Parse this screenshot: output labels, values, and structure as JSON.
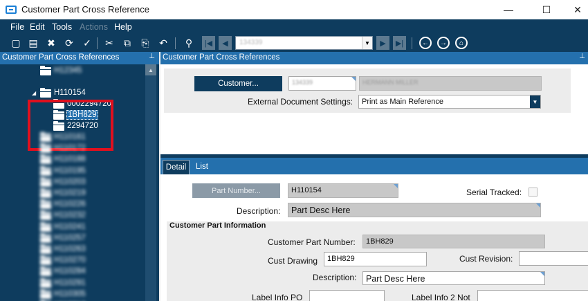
{
  "window": {
    "title": "Customer Part Cross Reference",
    "minimize_glyph": "—",
    "maximize_glyph": "☐",
    "close_glyph": "✕"
  },
  "menu": {
    "items": [
      {
        "label": "File",
        "enabled": true
      },
      {
        "label": "Edit",
        "enabled": true
      },
      {
        "label": "Tools",
        "enabled": true
      },
      {
        "label": "Actions",
        "enabled": false
      },
      {
        "label": "Help",
        "enabled": true
      }
    ]
  },
  "toolbar": {
    "record_value": "134339",
    "icons": [
      "new-icon",
      "save-icon",
      "delete-icon",
      "refresh-icon",
      "clear-icon",
      "cut-icon",
      "copy-icon",
      "paste-icon",
      "undo-icon",
      "binoculars-icon",
      "first-record-icon",
      "previous-record-icon",
      "next-record-icon",
      "last-record-icon",
      "back-icon",
      "forward-icon",
      "home-icon"
    ]
  },
  "tree_panel": {
    "header": "Customer Part Cross References",
    "pin_glyph": "⊥",
    "above_blurred": [
      {
        "label": "H12345"
      }
    ],
    "expanded_node": {
      "label": "H110154",
      "children": [
        {
          "label": "0002294720",
          "selected": false
        },
        {
          "label": "1BH829",
          "selected": true
        },
        {
          "label": "2294720",
          "selected": false
        }
      ]
    },
    "below_blurred": [
      {
        "label": "H110161"
      },
      {
        "label": "H110172"
      },
      {
        "label": "H110188"
      },
      {
        "label": "H110195"
      },
      {
        "label": "H110203"
      },
      {
        "label": "H110219"
      },
      {
        "label": "H110226"
      },
      {
        "label": "H110232"
      },
      {
        "label": "H110241"
      },
      {
        "label": "H110257"
      },
      {
        "label": "H110263"
      },
      {
        "label": "H110270"
      },
      {
        "label": "H110284"
      },
      {
        "label": "H110291"
      },
      {
        "label": "H110305"
      },
      {
        "label": "H110312"
      }
    ]
  },
  "customer_panel": {
    "header": "Customer Part Cross References",
    "customer_button": "Customer...",
    "customer_id": "134339",
    "customer_name": "HERMANN MILLER",
    "external_doc_label": "External Document Settings:",
    "external_doc_value": "Print as Main Reference"
  },
  "detail": {
    "tabs": [
      {
        "label": "Detail",
        "active": true
      },
      {
        "label": "List",
        "active": false
      }
    ],
    "part_number_button": "Part Number...",
    "part_number": "H110154",
    "serial_tracked_label": "Serial Tracked:",
    "serial_tracked": false,
    "description_label": "Description:",
    "description": "Part Desc Here",
    "section_title": "Customer Part Information",
    "customer_part_number_label": "Customer Part Number:",
    "customer_part_number": "1BH829",
    "cust_drawing_label": "Cust Drawing",
    "cust_drawing": "1BH829",
    "cust_revision_label": "Cust Revision:",
    "cust_revision": "",
    "cust_description_label": "Description:",
    "cust_description": "Part Desc Here",
    "label_info_po_label": "Label Info PO",
    "label_info_po": "",
    "label_info_2_label": "Label Info 2 Not",
    "label_info_2": ""
  },
  "colors": {
    "navy": "#0e3c5e",
    "header_blue": "#2470ad",
    "highlight_red": "#e0101e"
  }
}
